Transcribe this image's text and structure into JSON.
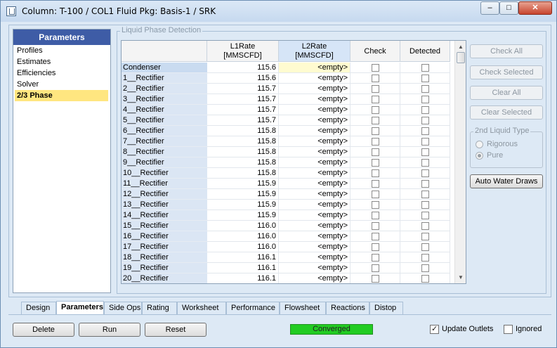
{
  "window": {
    "title": "Column: T-100 / COL1  Fluid Pkg: Basis-1 / SRK"
  },
  "titlebar_buttons": {
    "minimize": "–",
    "maximize": "□",
    "close": "✕"
  },
  "nav": {
    "header": "Parameters",
    "items": [
      "Profiles",
      "Estimates",
      "Efficiencies",
      "Solver",
      "2/3 Phase"
    ],
    "selected_index": 4
  },
  "group": {
    "label": "Liquid Phase Detection"
  },
  "grid": {
    "headers": {
      "l1": "L1Rate\n[MMSCFD]",
      "l2": "L2Rate\n[MMSCFD]",
      "check": "Check",
      "detected": "Detected"
    },
    "rows": [
      {
        "name": "Condenser",
        "l1": "115.6",
        "l2": "<empty>"
      },
      {
        "name": "1__Rectifier",
        "l1": "115.6",
        "l2": "<empty>"
      },
      {
        "name": "2__Rectifier",
        "l1": "115.7",
        "l2": "<empty>"
      },
      {
        "name": "3__Rectifier",
        "l1": "115.7",
        "l2": "<empty>"
      },
      {
        "name": "4__Rectifier",
        "l1": "115.7",
        "l2": "<empty>"
      },
      {
        "name": "5__Rectifier",
        "l1": "115.7",
        "l2": "<empty>"
      },
      {
        "name": "6__Rectifier",
        "l1": "115.8",
        "l2": "<empty>"
      },
      {
        "name": "7__Rectifier",
        "l1": "115.8",
        "l2": "<empty>"
      },
      {
        "name": "8__Rectifier",
        "l1": "115.8",
        "l2": "<empty>"
      },
      {
        "name": "9__Rectifier",
        "l1": "115.8",
        "l2": "<empty>"
      },
      {
        "name": "10__Rectifier",
        "l1": "115.8",
        "l2": "<empty>"
      },
      {
        "name": "11__Rectifier",
        "l1": "115.9",
        "l2": "<empty>"
      },
      {
        "name": "12__Rectifier",
        "l1": "115.9",
        "l2": "<empty>"
      },
      {
        "name": "13__Rectifier",
        "l1": "115.9",
        "l2": "<empty>"
      },
      {
        "name": "14__Rectifier",
        "l1": "115.9",
        "l2": "<empty>"
      },
      {
        "name": "15__Rectifier",
        "l1": "116.0",
        "l2": "<empty>"
      },
      {
        "name": "16__Rectifier",
        "l1": "116.0",
        "l2": "<empty>"
      },
      {
        "name": "17__Rectifier",
        "l1": "116.0",
        "l2": "<empty>"
      },
      {
        "name": "18__Rectifier",
        "l1": "116.1",
        "l2": "<empty>"
      },
      {
        "name": "19__Rectifier",
        "l1": "116.1",
        "l2": "<empty>"
      },
      {
        "name": "20__Rectifier",
        "l1": "116.1",
        "l2": "<empty>"
      }
    ]
  },
  "side_buttons": {
    "check_all": "Check All",
    "check_selected": "Check Selected",
    "clear_all": "Clear All",
    "clear_selected": "Clear Selected",
    "auto_water_draws": "Auto Water Draws"
  },
  "liquid_type": {
    "label": "2nd Liquid Type",
    "rigorous": "Rigorous",
    "pure": "Pure",
    "selected": "Pure"
  },
  "tabs": [
    "Design",
    "Parameters",
    "Side Ops",
    "Rating",
    "Worksheet",
    "Performance",
    "Flowsheet",
    "Reactions",
    "Distop"
  ],
  "active_tab": "Parameters",
  "bottom": {
    "delete": "Delete",
    "run": "Run",
    "reset": "Reset",
    "status": "Converged",
    "update_outlets": "Update Outlets",
    "update_outlets_checked": true,
    "ignored": "Ignored",
    "ignored_checked": false
  },
  "colors": {
    "nav_header": "#3e5ca6",
    "selected_item": "#ffe680",
    "status_ok": "#22cc22"
  }
}
